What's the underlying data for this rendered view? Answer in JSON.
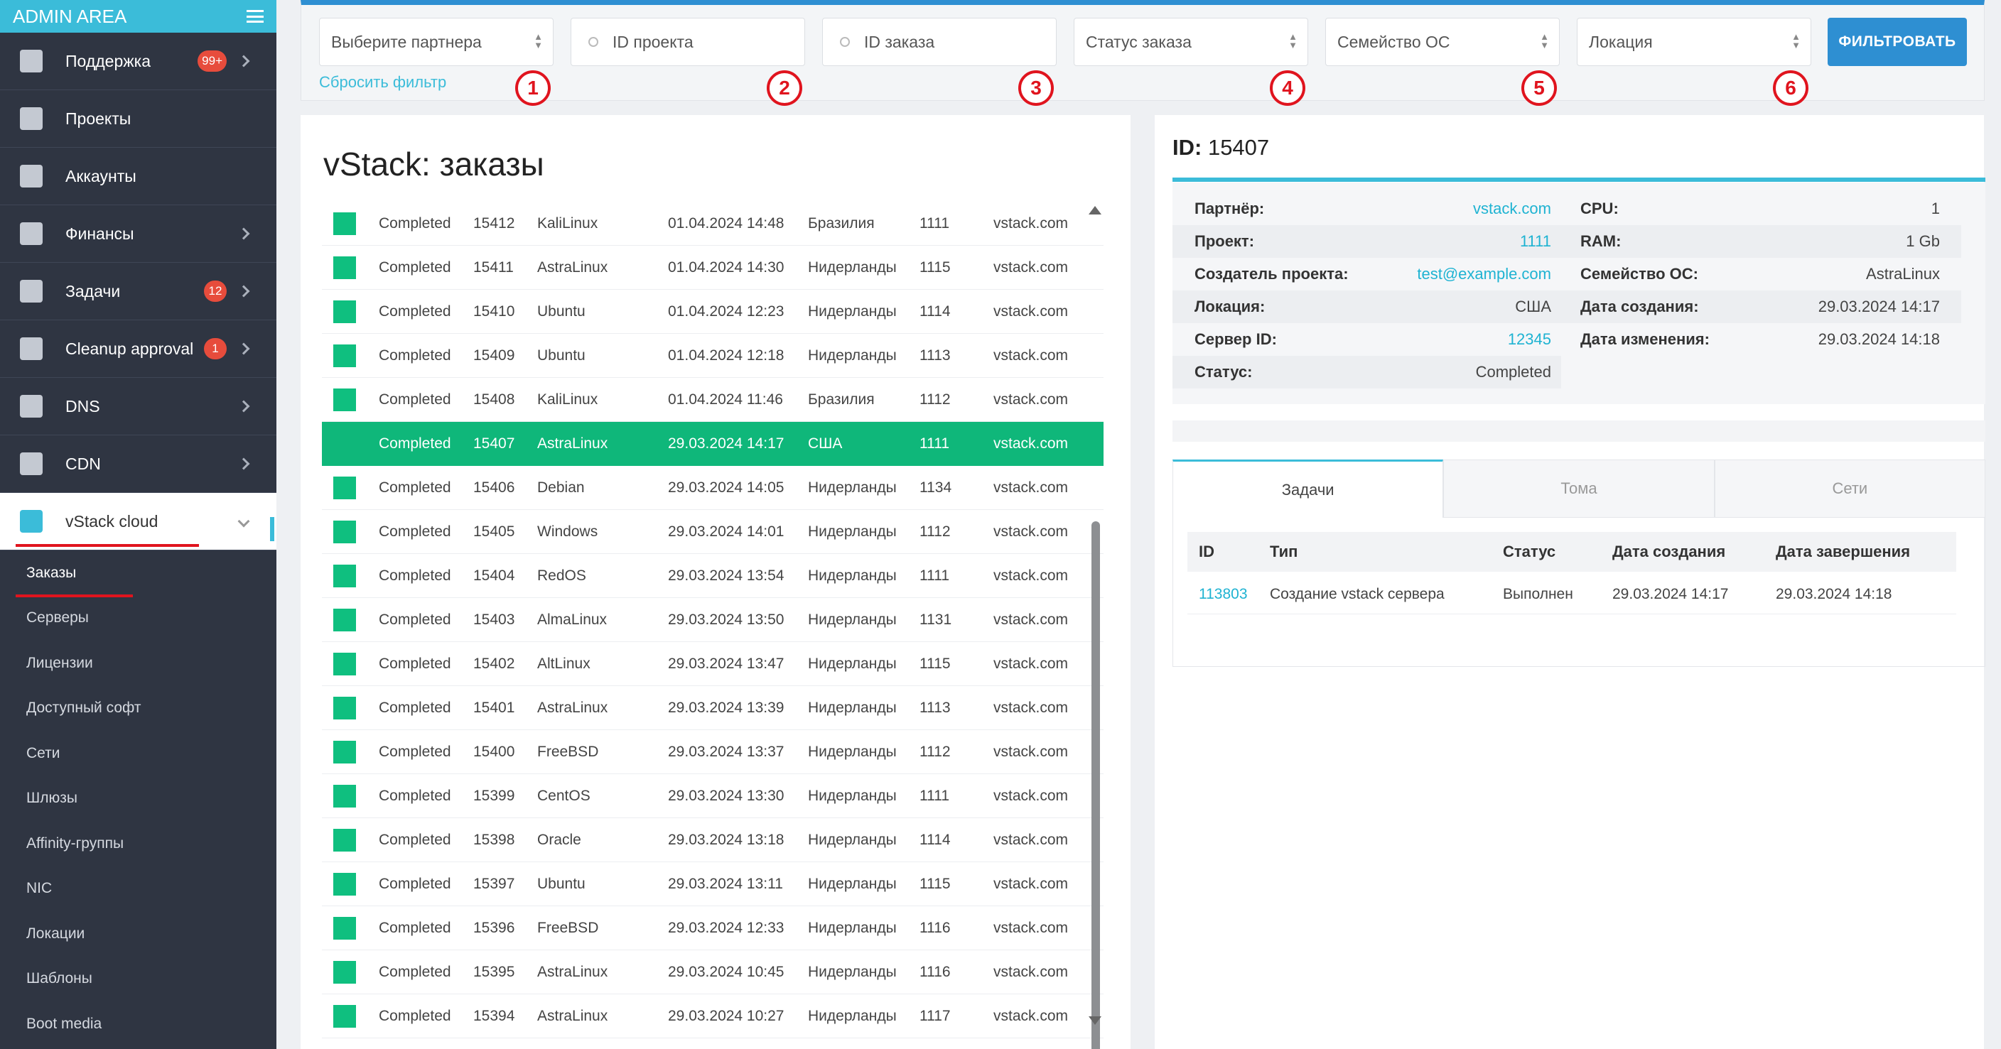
{
  "sidebar": {
    "brand": "ADMIN AREA",
    "items": [
      {
        "label": "Поддержка",
        "badge": "99+",
        "chevron": true,
        "icon": "fire-icon"
      },
      {
        "label": "Проекты",
        "badge": "",
        "chevron": false,
        "icon": "puzzle-icon"
      },
      {
        "label": "Аккаунты",
        "badge": "",
        "chevron": false,
        "icon": "users-icon"
      },
      {
        "label": "Финансы",
        "badge": "",
        "chevron": true,
        "icon": "money-icon"
      },
      {
        "label": "Задачи",
        "badge": "12",
        "chevron": true,
        "icon": "book-icon"
      },
      {
        "label": "Cleanup approval",
        "badge": "1",
        "chevron": true,
        "icon": "trash-icon"
      },
      {
        "label": "DNS",
        "badge": "",
        "chevron": true,
        "icon": "rocket-icon"
      },
      {
        "label": "CDN",
        "badge": "",
        "chevron": true,
        "icon": "globe-icon"
      },
      {
        "label": "vStack cloud",
        "badge": "",
        "chevron": true,
        "icon": "server-icon",
        "active": true
      }
    ],
    "submenu": [
      "Заказы",
      "Серверы",
      "Лицензии",
      "Доступный софт",
      "Сети",
      "Шлюзы",
      "Affinity-группы",
      "NIC",
      "Локации",
      "Шаблоны",
      "Boot media"
    ]
  },
  "filters": {
    "partner_placeholder": "Выберите партнера",
    "project_id_placeholder": "ID проекта",
    "order_id_placeholder": "ID заказа",
    "status_placeholder": "Статус заказа",
    "os_family_placeholder": "Семейство ОС",
    "location_placeholder": "Локация",
    "reset_label": "Сбросить фильтр",
    "filter_button": "ФИЛЬТРОВАТЬ",
    "markers": [
      "1",
      "2",
      "3",
      "4",
      "5",
      "6"
    ]
  },
  "orders": {
    "title": "vStack: заказы",
    "rows": [
      {
        "status": "Completed",
        "id": "15412",
        "os": "KaliLinux",
        "date": "01.04.2024 14:48",
        "location": "Бразилия",
        "project": "1111",
        "partner": "vstack.com"
      },
      {
        "status": "Completed",
        "id": "15411",
        "os": "AstraLinux",
        "date": "01.04.2024 14:30",
        "location": "Нидерланды",
        "project": "1115",
        "partner": "vstack.com"
      },
      {
        "status": "Completed",
        "id": "15410",
        "os": "Ubuntu",
        "date": "01.04.2024 12:23",
        "location": "Нидерланды",
        "project": "1114",
        "partner": "vstack.com"
      },
      {
        "status": "Completed",
        "id": "15409",
        "os": "Ubuntu",
        "date": "01.04.2024 12:18",
        "location": "Нидерланды",
        "project": "1113",
        "partner": "vstack.com"
      },
      {
        "status": "Completed",
        "id": "15408",
        "os": "KaliLinux",
        "date": "01.04.2024 11:46",
        "location": "Бразилия",
        "project": "1112",
        "partner": "vstack.com"
      },
      {
        "status": "Completed",
        "id": "15407",
        "os": "AstraLinux",
        "date": "29.03.2024 14:17",
        "location": "США",
        "project": "1111",
        "partner": "vstack.com",
        "selected": true
      },
      {
        "status": "Completed",
        "id": "15406",
        "os": "Debian",
        "date": "29.03.2024 14:05",
        "location": "Нидерланды",
        "project": "1134",
        "partner": "vstack.com"
      },
      {
        "status": "Completed",
        "id": "15405",
        "os": "Windows",
        "date": "29.03.2024 14:01",
        "location": "Нидерланды",
        "project": "1112",
        "partner": "vstack.com"
      },
      {
        "status": "Completed",
        "id": "15404",
        "os": "RedOS",
        "date": "29.03.2024 13:54",
        "location": "Нидерланды",
        "project": "1111",
        "partner": "vstack.com"
      },
      {
        "status": "Completed",
        "id": "15403",
        "os": "AlmaLinux",
        "date": "29.03.2024 13:50",
        "location": "Нидерланды",
        "project": "1131",
        "partner": "vstack.com"
      },
      {
        "status": "Completed",
        "id": "15402",
        "os": "AltLinux",
        "date": "29.03.2024 13:47",
        "location": "Нидерланды",
        "project": "1115",
        "partner": "vstack.com"
      },
      {
        "status": "Completed",
        "id": "15401",
        "os": "AstraLinux",
        "date": "29.03.2024 13:39",
        "location": "Нидерланды",
        "project": "1113",
        "partner": "vstack.com"
      },
      {
        "status": "Completed",
        "id": "15400",
        "os": "FreeBSD",
        "date": "29.03.2024 13:37",
        "location": "Нидерланды",
        "project": "1112",
        "partner": "vstack.com"
      },
      {
        "status": "Completed",
        "id": "15399",
        "os": "CentOS",
        "date": "29.03.2024 13:30",
        "location": "Нидерланды",
        "project": "1111",
        "partner": "vstack.com"
      },
      {
        "status": "Completed",
        "id": "15398",
        "os": "Oracle",
        "date": "29.03.2024 13:18",
        "location": "Нидерланды",
        "project": "1114",
        "partner": "vstack.com"
      },
      {
        "status": "Completed",
        "id": "15397",
        "os": "Ubuntu",
        "date": "29.03.2024 13:11",
        "location": "Нидерланды",
        "project": "1115",
        "partner": "vstack.com"
      },
      {
        "status": "Completed",
        "id": "15396",
        "os": "FreeBSD",
        "date": "29.03.2024 12:33",
        "location": "Нидерланды",
        "project": "1116",
        "partner": "vstack.com"
      },
      {
        "status": "Completed",
        "id": "15395",
        "os": "AstraLinux",
        "date": "29.03.2024 10:45",
        "location": "Нидерланды",
        "project": "1116",
        "partner": "vstack.com"
      },
      {
        "status": "Completed",
        "id": "15394",
        "os": "AstraLinux",
        "date": "29.03.2024 10:27",
        "location": "Нидерланды",
        "project": "1117",
        "partner": "vstack.com"
      }
    ]
  },
  "details": {
    "id_label": "ID:",
    "id_value": "15407",
    "left": [
      {
        "k": "Партнёр:",
        "v": "vstack.com",
        "link": true
      },
      {
        "k": "Проект:",
        "v": "1111",
        "link": true
      },
      {
        "k": "Создатель проекта:",
        "v": "test@example.com",
        "link": true
      },
      {
        "k": "Локация:",
        "v": "США",
        "link": false
      },
      {
        "k": "Сервер ID:",
        "v": "12345",
        "link": true
      },
      {
        "k": "Статус:",
        "v": "Completed",
        "link": false
      }
    ],
    "right": [
      {
        "k": "CPU:",
        "v": "1"
      },
      {
        "k": "RAM:",
        "v": "1 Gb"
      },
      {
        "k": "Семейство ОС:",
        "v": "AstraLinux"
      },
      {
        "k": "Дата создания:",
        "v": "29.03.2024 14:17"
      },
      {
        "k": "Дата изменения:",
        "v": "29.03.2024 14:18"
      }
    ],
    "tabs": [
      "Задачи",
      "Тома",
      "Сети"
    ],
    "task_headers": [
      "ID",
      "Тип",
      "Статус",
      "Дата создания",
      "Дата завершения"
    ],
    "task_rows": [
      {
        "id": "113803",
        "type": "Создание vstack сервера",
        "status": "Выполнен",
        "created": "29.03.2024 14:17",
        "done": "29.03.2024 14:18"
      }
    ]
  },
  "colors": {
    "accent": "#3bbcd9",
    "primary_button": "#2e8fd2",
    "success": "#0fbf7f",
    "sidebar_bg": "#2f3542",
    "badge": "#e74c3c",
    "annotation_red": "#e0141e"
  }
}
